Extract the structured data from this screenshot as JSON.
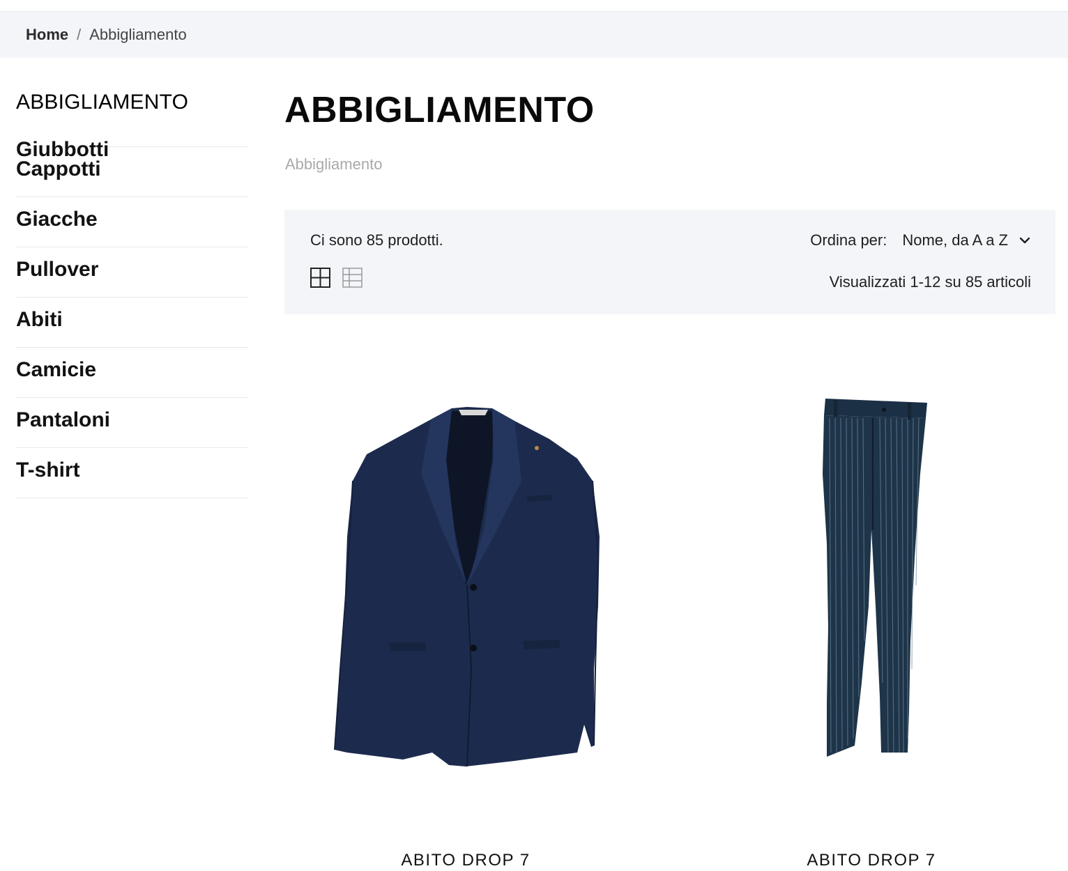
{
  "breadcrumb": {
    "home": "Home",
    "separator": "/",
    "current": "Abbigliamento"
  },
  "sidebar": {
    "title": "ABBIGLIAMENTO",
    "items": [
      {
        "label": "Giubbotti"
      },
      {
        "label": "Cappotti"
      },
      {
        "label": "Giacche"
      },
      {
        "label": "Pullover"
      },
      {
        "label": "Abiti"
      },
      {
        "label": "Camicie"
      },
      {
        "label": "Pantaloni"
      },
      {
        "label": "T-shirt"
      }
    ]
  },
  "main": {
    "title": "ABBIGLIAMENTO",
    "subtitle": "Abbigliamento"
  },
  "toolbar": {
    "product_count": "Ci sono 85 prodotti.",
    "sort_label": "Ordina per:",
    "sort_value": "Nome, da A a Z",
    "showing": "Visualizzati 1-12 su 85 articoli",
    "view_modes": [
      "grid-2-icon",
      "grid-3-icon"
    ],
    "active_view": "grid-2-icon"
  },
  "products": [
    {
      "name": "ABITO DROP 7",
      "image": "navy-suit-jacket"
    },
    {
      "name": "ABITO DROP 7",
      "image": "pinstripe-trousers"
    }
  ],
  "colors": {
    "breadcrumb_bg": "#f4f5f9",
    "toolbar_bg": "#f4f5f9",
    "navy": "#1b2a4a",
    "muted_text": "#a9a9a9"
  }
}
